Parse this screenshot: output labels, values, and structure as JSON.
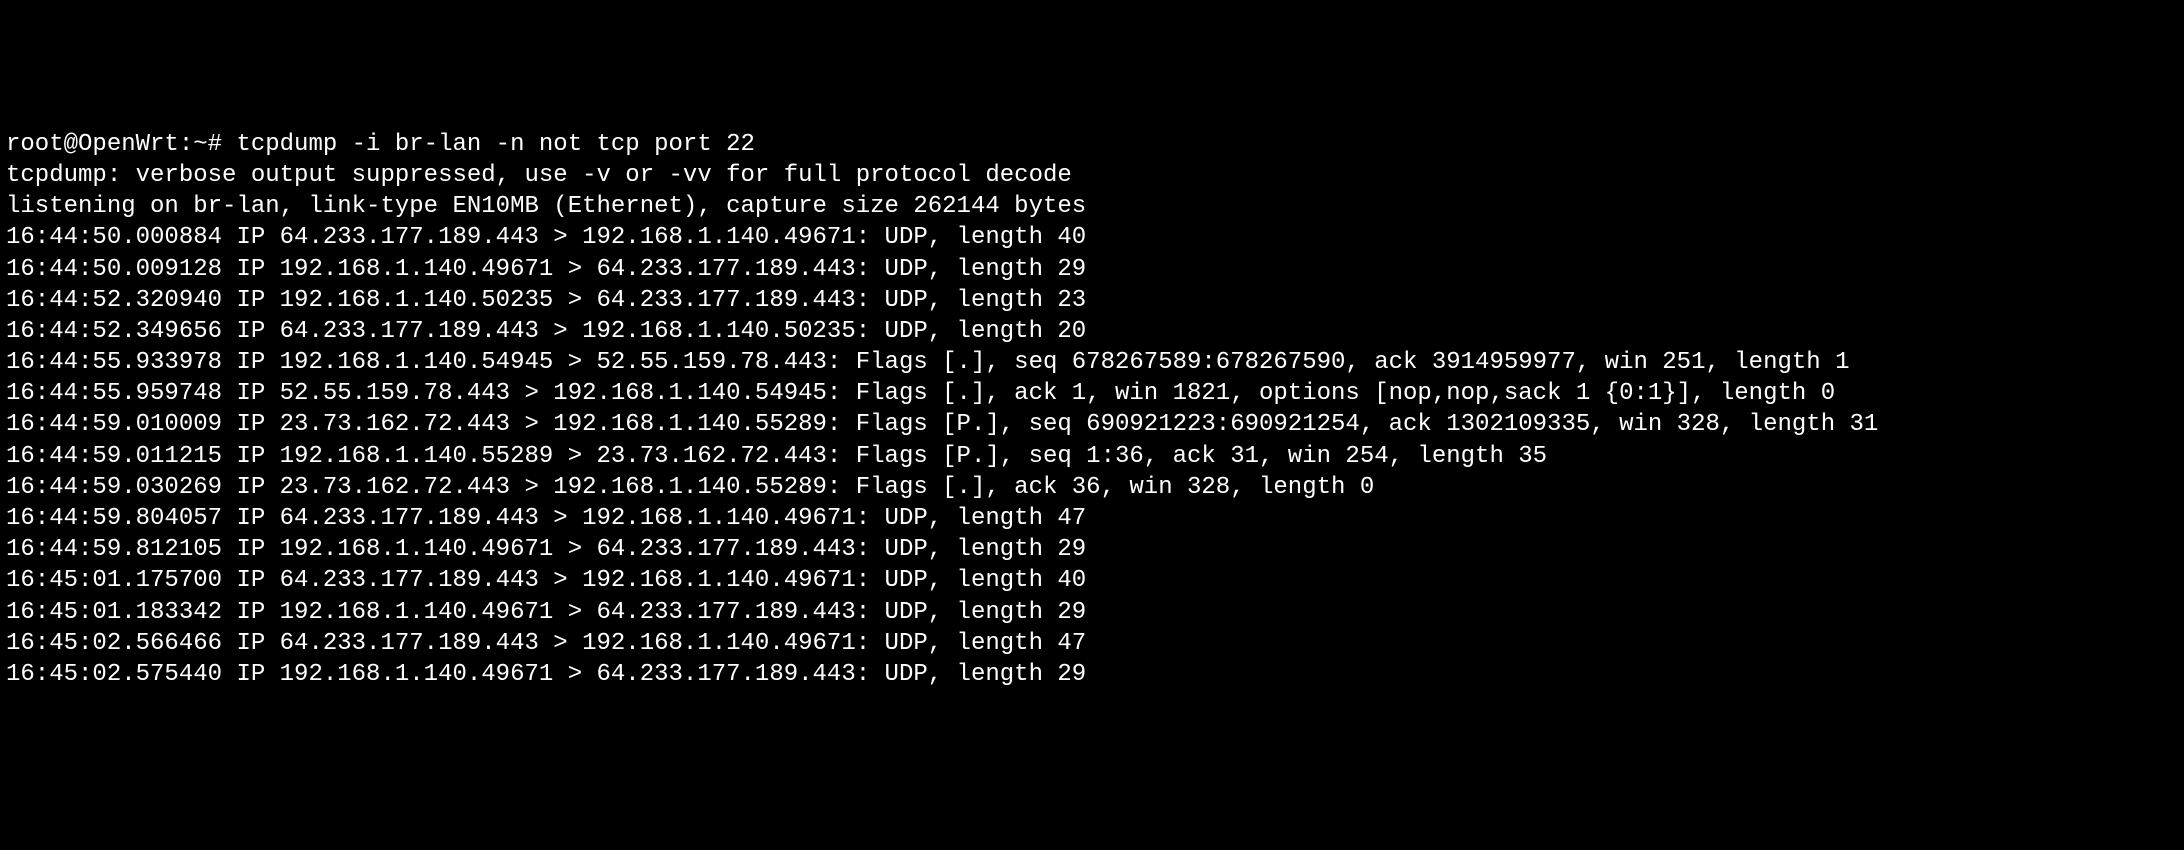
{
  "prompt": "root@OpenWrt:~# ",
  "command": "tcpdump -i br-lan -n not tcp port 22",
  "lines": [
    "tcpdump: verbose output suppressed, use -v or -vv for full protocol decode",
    "listening on br-lan, link-type EN10MB (Ethernet), capture size 262144 bytes",
    "16:44:50.000884 IP 64.233.177.189.443 > 192.168.1.140.49671: UDP, length 40",
    "16:44:50.009128 IP 192.168.1.140.49671 > 64.233.177.189.443: UDP, length 29",
    "16:44:52.320940 IP 192.168.1.140.50235 > 64.233.177.189.443: UDP, length 23",
    "16:44:52.349656 IP 64.233.177.189.443 > 192.168.1.140.50235: UDP, length 20",
    "16:44:55.933978 IP 192.168.1.140.54945 > 52.55.159.78.443: Flags [.], seq 678267589:678267590, ack 3914959977, win 251, length 1",
    "16:44:55.959748 IP 52.55.159.78.443 > 192.168.1.140.54945: Flags [.], ack 1, win 1821, options [nop,nop,sack 1 {0:1}], length 0",
    "16:44:59.010009 IP 23.73.162.72.443 > 192.168.1.140.55289: Flags [P.], seq 690921223:690921254, ack 1302109335, win 328, length 31",
    "16:44:59.011215 IP 192.168.1.140.55289 > 23.73.162.72.443: Flags [P.], seq 1:36, ack 31, win 254, length 35",
    "16:44:59.030269 IP 23.73.162.72.443 > 192.168.1.140.55289: Flags [.], ack 36, win 328, length 0",
    "16:44:59.804057 IP 64.233.177.189.443 > 192.168.1.140.49671: UDP, length 47",
    "16:44:59.812105 IP 192.168.1.140.49671 > 64.233.177.189.443: UDP, length 29",
    "16:45:01.175700 IP 64.233.177.189.443 > 192.168.1.140.49671: UDP, length 40",
    "16:45:01.183342 IP 192.168.1.140.49671 > 64.233.177.189.443: UDP, length 29",
    "16:45:02.566466 IP 64.233.177.189.443 > 192.168.1.140.49671: UDP, length 47",
    "16:45:02.575440 IP 192.168.1.140.49671 > 64.233.177.189.443: UDP, length 29"
  ]
}
